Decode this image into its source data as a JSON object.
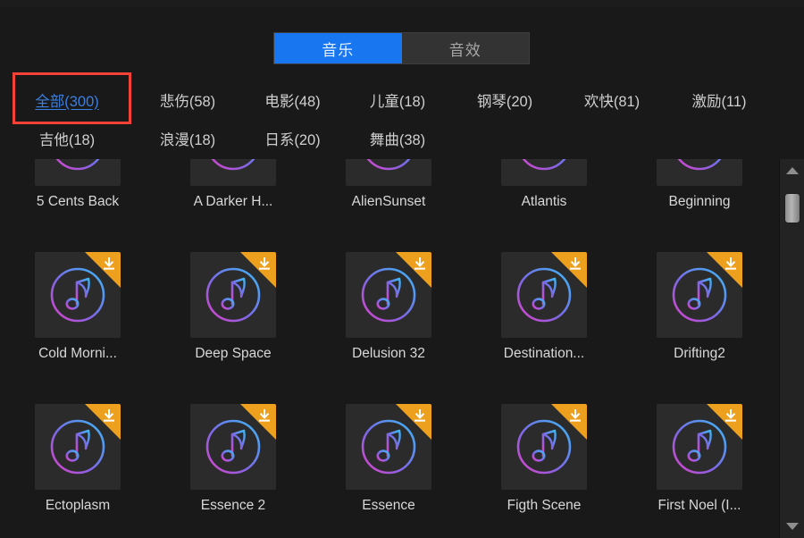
{
  "tabs": [
    {
      "label": "音乐",
      "active": true,
      "name": "tab-music"
    },
    {
      "label": "音效",
      "active": false,
      "name": "tab-sound-effects"
    }
  ],
  "categories": [
    [
      {
        "label": "全部(300)",
        "selected": true
      },
      {
        "label": "悲伤(58)",
        "selected": false
      },
      {
        "label": "电影(48)",
        "selected": false
      },
      {
        "label": "儿童(18)",
        "selected": false
      },
      {
        "label": "钢琴(20)",
        "selected": false
      },
      {
        "label": "欢快(81)",
        "selected": false
      },
      {
        "label": "激励(11)",
        "selected": false
      }
    ],
    [
      {
        "label": "吉他(18)",
        "selected": false
      },
      {
        "label": "浪漫(18)",
        "selected": false
      },
      {
        "label": "日系(20)",
        "selected": false
      },
      {
        "label": "舞曲(38)",
        "selected": false
      }
    ]
  ],
  "grid": {
    "rows": [
      {
        "clipped": true,
        "items": [
          {
            "title": "5 Cents Back",
            "downloadable": true
          },
          {
            "title": "A Darker H...",
            "downloadable": true
          },
          {
            "title": "AlienSunset",
            "downloadable": true
          },
          {
            "title": "Atlantis",
            "downloadable": true
          },
          {
            "title": "Beginning",
            "downloadable": true
          }
        ]
      },
      {
        "clipped": false,
        "items": [
          {
            "title": "Cold Morni...",
            "downloadable": true
          },
          {
            "title": "Deep Space",
            "downloadable": true
          },
          {
            "title": "Delusion 32",
            "downloadable": true
          },
          {
            "title": "Destination...",
            "downloadable": true
          },
          {
            "title": "Drifting2",
            "downloadable": true
          }
        ]
      },
      {
        "clipped": false,
        "items": [
          {
            "title": "Ectoplasm",
            "downloadable": true
          },
          {
            "title": "Essence 2",
            "downloadable": true
          },
          {
            "title": "Essence",
            "downloadable": true
          },
          {
            "title": "Figth Scene",
            "downloadable": true
          },
          {
            "title": "First Noel (I...",
            "downloadable": true
          }
        ]
      }
    ]
  },
  "icons": {
    "music_note": "music-note-icon",
    "download": "download-icon",
    "scroll_up": "scroll-up-arrow-icon",
    "scroll_down": "scroll-down-arrow-icon"
  },
  "colors": {
    "accent_tab": "#1877f0",
    "selected_category": "#3b7fe0",
    "highlight_box": "#f44336",
    "badge_orange": "#eda01e",
    "note_gradient_start": "#3bb9f5",
    "note_gradient_end": "#e040c8",
    "background": "#191919",
    "tile_background": "#2b2b2b"
  }
}
